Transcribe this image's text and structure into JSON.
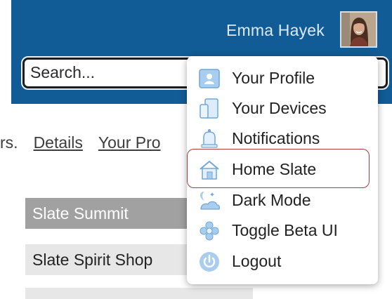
{
  "header": {
    "user_name": "Emma Hayek",
    "background_color": "#115c96"
  },
  "search": {
    "placeholder": "Search..."
  },
  "links": {
    "lead_text": "rs.",
    "items": [
      "Details",
      "Your Pro"
    ]
  },
  "list": {
    "rows": [
      "Slate Summit",
      "Slate Spirit Shop"
    ]
  },
  "user_menu": {
    "items": [
      {
        "label": "Your Profile",
        "icon": "profile-icon"
      },
      {
        "label": "Your Devices",
        "icon": "devices-icon"
      },
      {
        "label": "Notifications",
        "icon": "bell-icon"
      },
      {
        "label": "Home Slate",
        "icon": "home-icon",
        "highlighted": true
      },
      {
        "label": "Dark Mode",
        "icon": "dark-mode-icon"
      },
      {
        "label": "Toggle Beta UI",
        "icon": "beta-toggle-icon"
      },
      {
        "label": "Logout",
        "icon": "power-icon"
      }
    ],
    "highlight_color": "#b23a3a"
  }
}
